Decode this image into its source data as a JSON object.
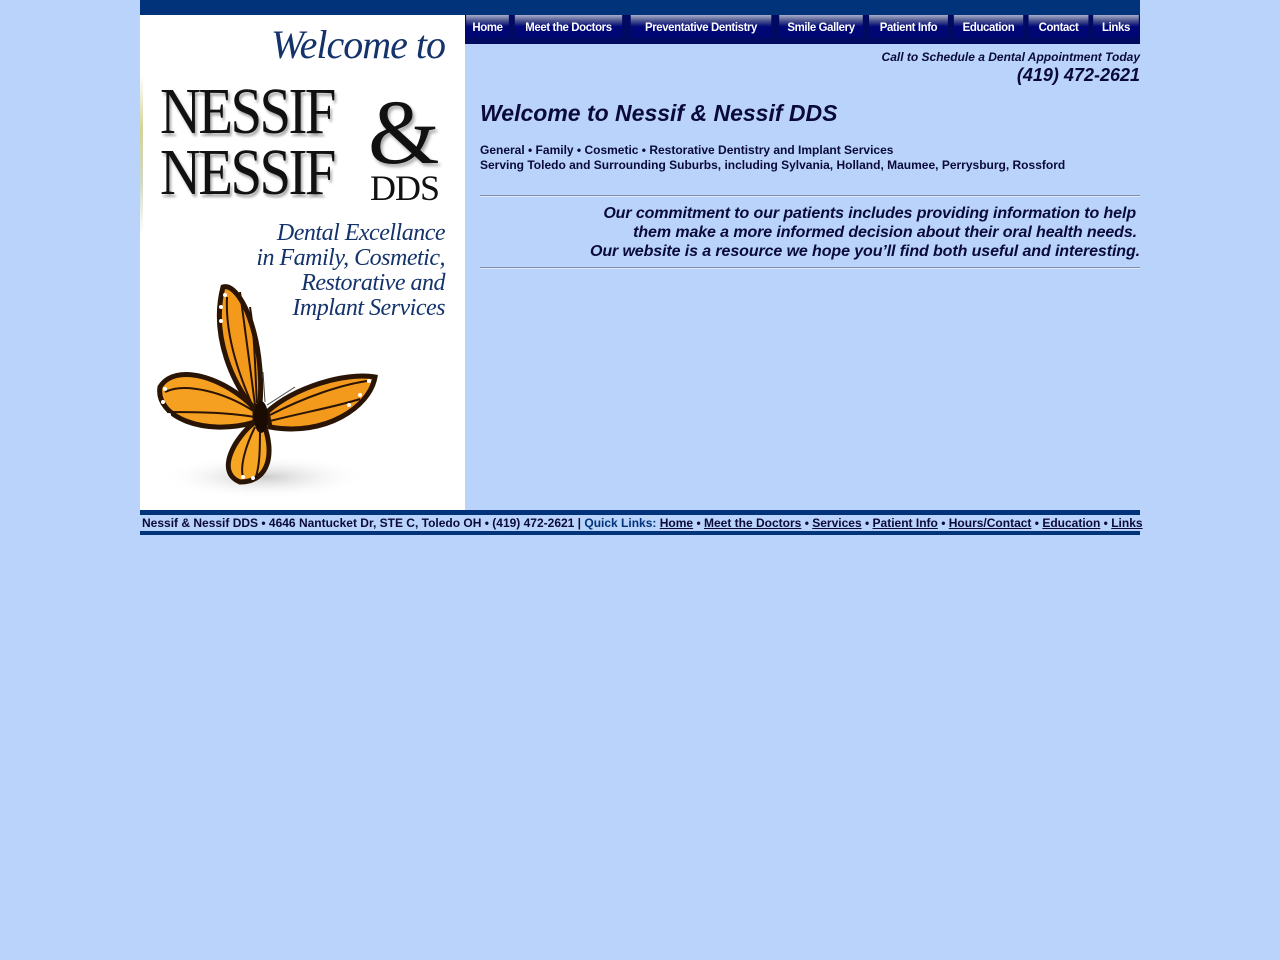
{
  "logo": {
    "welcome_to": "Welcome to",
    "line1": "NESSIF",
    "amp": "&",
    "line2": "NESSIF",
    "dds": "DDS",
    "tagline": [
      "Dental Excellance",
      "in Family, Cosmetic,",
      "Restorative and",
      "Implant Services"
    ],
    "image": "monarch-butterfly"
  },
  "nav": {
    "items": [
      {
        "label": "Home"
      },
      {
        "label": "Meet the Doctors"
      },
      {
        "label": "Preventative Dentistry"
      },
      {
        "label": "Smile Gallery"
      },
      {
        "label": "Patient Info"
      },
      {
        "label": "Education"
      },
      {
        "label": "Contact"
      },
      {
        "label": "Links"
      }
    ]
  },
  "header": {
    "call_text": "Call to Schedule a Dental Appointment Today",
    "phone": "(419) 472-2621"
  },
  "main": {
    "title": "Welcome to Nessif & Nessif DDS",
    "services_line": "General • Family • Cosmetic • Restorative Dentistry and Implant Services",
    "serving_line": "Serving Toledo and Surrounding Suburbs, including Sylvania, Holland, Maumee, Perrysburg, Rossford",
    "commitment": [
      "Our commitment to our patients includes providing information to help",
      "them make a more informed decision about their oral health needs.",
      "Our website is a resource we hope you’ll find both useful and interesting."
    ]
  },
  "footer": {
    "info": "Nessif & Nessif DDS • 4646 Nantucket Dr, STE C, Toledo OH • (419) 472-2621 |",
    "quick_links_label": "Quick Links:",
    "separator": "•",
    "links": [
      {
        "label": "Home"
      },
      {
        "label": "Meet the Doctors"
      },
      {
        "label": "Services"
      },
      {
        "label": "Patient Info"
      },
      {
        "label": "Hours/Contact"
      },
      {
        "label": "Education"
      },
      {
        "label": "Links"
      }
    ]
  },
  "colors": {
    "page_bg": "#b9d3fb",
    "bar_blue": "#00337a",
    "nav_dark": "#000a60",
    "text_dark": "#0a0a3a"
  }
}
